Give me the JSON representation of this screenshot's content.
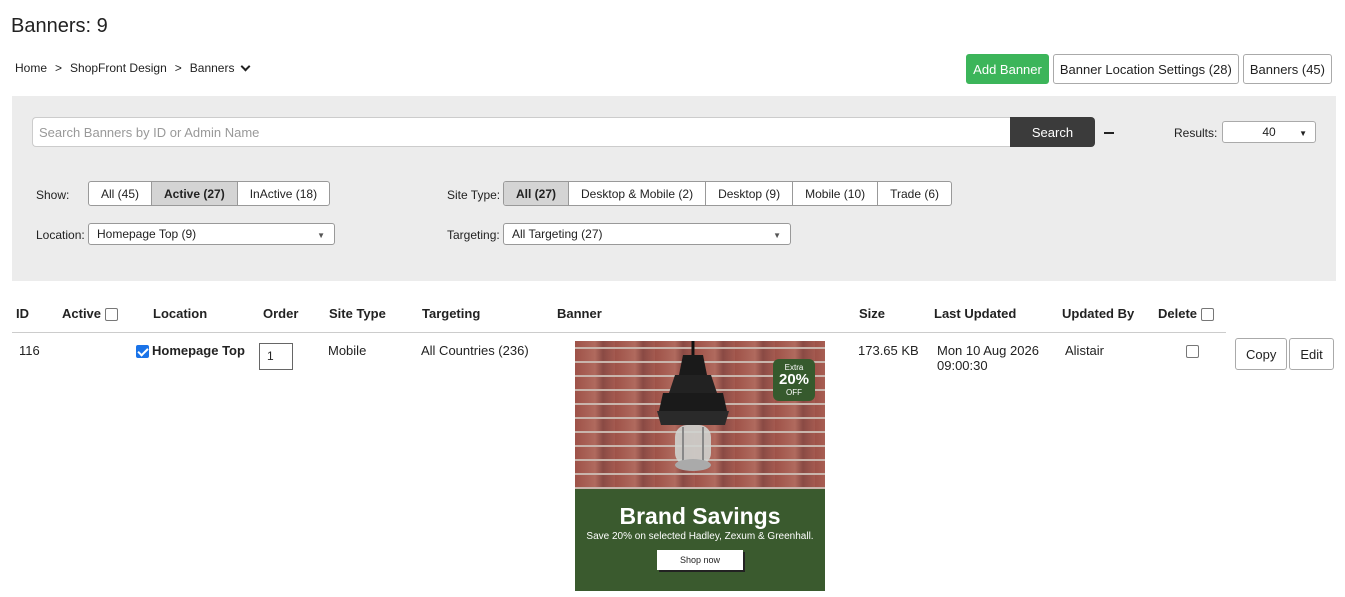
{
  "page": {
    "title": "Banners: 9"
  },
  "breadcrumb": {
    "home": "Home",
    "sep1": ">",
    "section": "ShopFront Design",
    "sep2": ">",
    "current": "Banners"
  },
  "top_buttons": {
    "add": "Add Banner",
    "location_settings": "Banner Location Settings (28)",
    "banners": "Banners (45)"
  },
  "search": {
    "placeholder": "Search Banners by ID or Admin Name",
    "button": "Search"
  },
  "results": {
    "label": "Results:",
    "value": "40"
  },
  "show": {
    "label": "Show:",
    "options": [
      "All (45)",
      "Active (27)",
      "InActive (18)"
    ],
    "selected": "Active (27)"
  },
  "site_type": {
    "label": "Site Type:",
    "options": [
      "All (27)",
      "Desktop & Mobile (2)",
      "Desktop (9)",
      "Mobile (10)",
      "Trade (6)"
    ],
    "selected": "All (27)"
  },
  "location": {
    "label": "Location:",
    "value": "Homepage Top (9)"
  },
  "targeting": {
    "label": "Targeting:",
    "value": "All Targeting (27)"
  },
  "table": {
    "headers": {
      "id": "ID",
      "active": "Active",
      "location": "Location",
      "order": "Order",
      "site_type": "Site Type",
      "targeting": "Targeting",
      "banner": "Banner",
      "size": "Size",
      "last_updated": "Last Updated",
      "updated_by": "Updated By",
      "delete": "Delete"
    },
    "rows": [
      {
        "id": "116",
        "active": true,
        "location": "Homepage Top",
        "order": "1",
        "site_type": "Mobile",
        "targeting": "All Countries (236)",
        "size": "173.65 KB",
        "last_updated_line1": "Mon 10 Aug 2026",
        "last_updated_line2": "09:00:30",
        "updated_by": "Alistair",
        "copy": "Copy",
        "edit": "Edit",
        "banner": {
          "badge_top": "Extra",
          "badge_pct": "20%",
          "badge_bottom": "OFF",
          "headline": "Brand Savings",
          "subline": "Save 20% on selected Hadley, Zexum & Greenhall.",
          "cta": "Shop now"
        }
      }
    ]
  }
}
